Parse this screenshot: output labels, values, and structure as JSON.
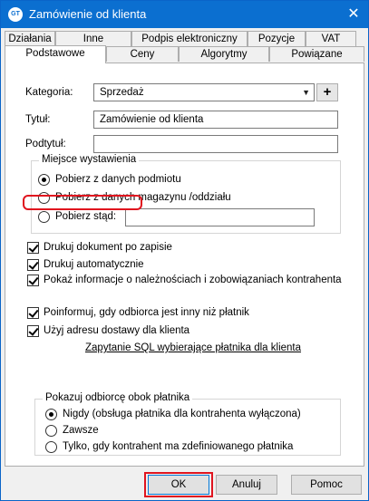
{
  "window": {
    "title": "Zamówienie od klienta",
    "icon_text": "GT",
    "close_glyph": "✕"
  },
  "tabs": {
    "row1": [
      "Działania",
      "Inne",
      "Podpis elektroniczny",
      "Pozycje",
      "VAT"
    ],
    "row2": [
      "Podstawowe",
      "Ceny",
      "Algorytmy",
      "Powiązane"
    ],
    "active": "Podstawowe"
  },
  "form": {
    "category_label": "Kategoria:",
    "category_value": "Sprzedaż",
    "add_glyph": "+",
    "title_label": "Tytuł:",
    "title_value": "Zamówienie od klienta",
    "subtitle_label": "Podtytuł:",
    "subtitle_value": ""
  },
  "issue_place": {
    "group_title": "Miejsce wystawienia",
    "options": [
      {
        "label": "Pobierz z danych podmiotu",
        "checked": true
      },
      {
        "label": "Pobierz z danych magazynu /oddziału",
        "checked": false
      },
      {
        "label": "Pobierz stąd:",
        "checked": false
      }
    ],
    "custom_value": ""
  },
  "checks": [
    {
      "label": "Drukuj dokument po zapisie",
      "checked": true
    },
    {
      "label": "Drukuj automatycznie",
      "checked": true
    },
    {
      "label": "Pokaż informacje o należnościach i zobowiązaniach kontrahenta",
      "checked": true
    },
    {
      "label": "Poinformuj, gdy odbiorca jest inny niż płatnik",
      "checked": true
    },
    {
      "label": "Użyj adresu dostawy dla klienta",
      "checked": true
    }
  ],
  "sql_link": "Zapytanie SQL wybierające płatnika dla klienta",
  "receiver": {
    "group_title": "Pokazuj odbiorcę obok płatnika",
    "options": [
      {
        "label": "Nigdy (obsługa płatnika dla kontrahenta wyłączona)",
        "checked": true
      },
      {
        "label": "Zawsze",
        "checked": false
      },
      {
        "label": "Tylko, gdy kontrahent ma zdefiniowanego płatnika",
        "checked": false
      }
    ]
  },
  "buttons": {
    "ok": "OK",
    "cancel": "Anuluj",
    "help": "Pomoc"
  },
  "colors": {
    "titlebar": "#0b6fd0",
    "highlight": "#e0151f"
  }
}
